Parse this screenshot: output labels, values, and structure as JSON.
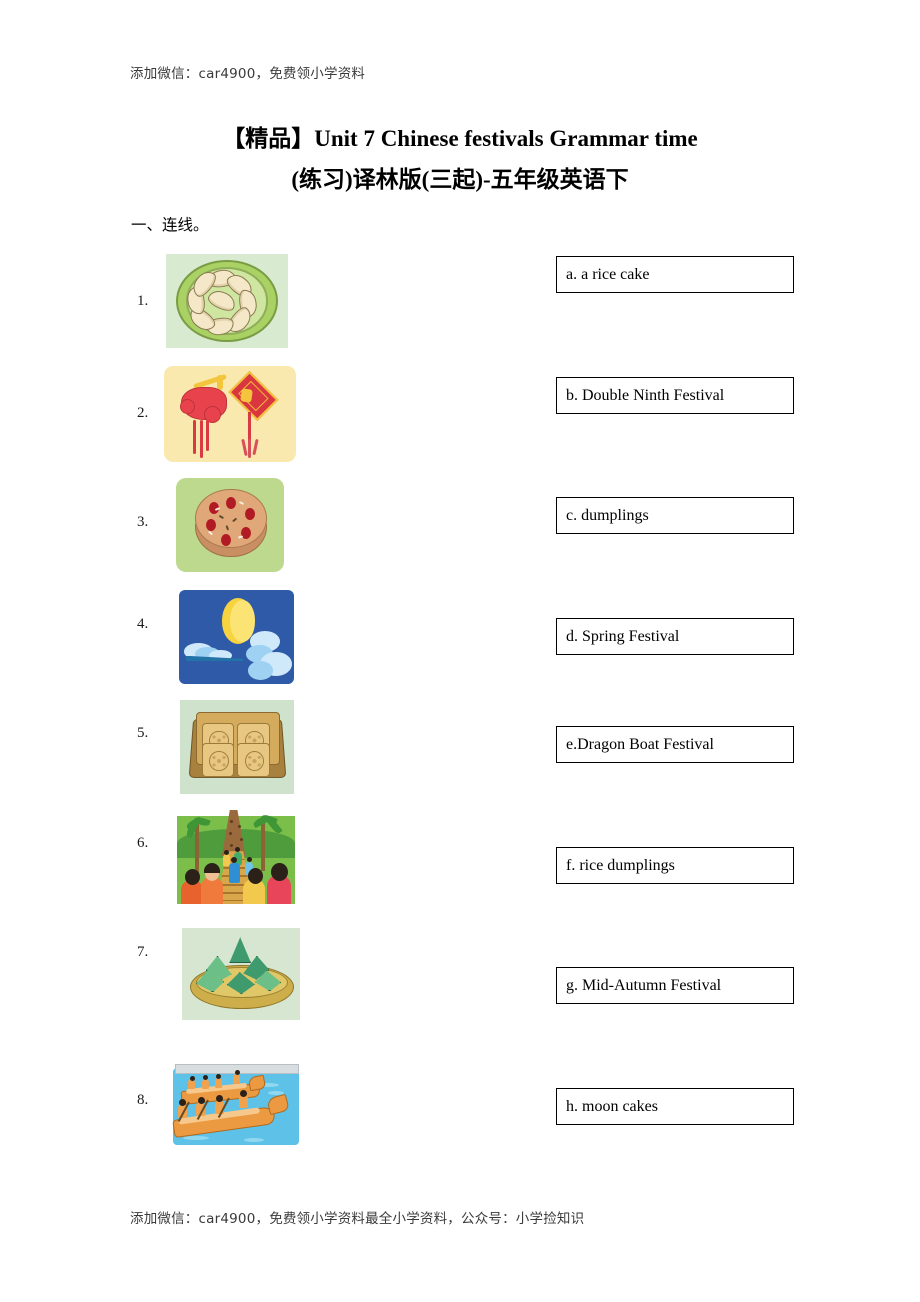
{
  "document": {
    "watermark_top": "添加微信：car4900，免费领小学资料",
    "watermark_bottom": "添加微信：car4900，免费领小学资料最全小学资料，公众号：小学捡知识",
    "title_line1": "【精品】Unit 7 Chinese festivals Grammar time",
    "title_line2": "(练习)译林版(三起)-五年级英语下",
    "section_heading": "一、连线。"
  },
  "exercise": {
    "numbers": [
      "1.",
      "2.",
      "3.",
      "4.",
      "5.",
      "6.",
      "7.",
      "8."
    ],
    "pictures": [
      {
        "number": "1.",
        "alt": "dumplings-on-green-plate"
      },
      {
        "number": "2.",
        "alt": "spring-festival-decorations"
      },
      {
        "number": "3.",
        "alt": "rice-cake-with-red-dates"
      },
      {
        "number": "4.",
        "alt": "moon-in-night-sky-with-clouds"
      },
      {
        "number": "5.",
        "alt": "box-of-moon-cakes"
      },
      {
        "number": "6.",
        "alt": "people-climbing-mountain-steps"
      },
      {
        "number": "7.",
        "alt": "rice-dumplings-zongzi-in-basket"
      },
      {
        "number": "8.",
        "alt": "dragon-boat-race"
      }
    ],
    "options": [
      {
        "key": "a",
        "label": "a. a rice cake"
      },
      {
        "key": "b",
        "label": "b. Double Ninth Festival"
      },
      {
        "key": "c",
        "label": "c. dumplings"
      },
      {
        "key": "d",
        "label": "d. Spring Festival"
      },
      {
        "key": "e",
        "label": "e.Dragon Boat Festival"
      },
      {
        "key": "f",
        "label": "f. rice dumplings"
      },
      {
        "key": "g",
        "label": "g. Mid-Autumn Festival"
      },
      {
        "key": "h",
        "label": "h. moon cakes"
      }
    ]
  },
  "colors": {
    "text": "#000000",
    "watermark": "#3a3a3a",
    "box_border": "#000000",
    "page_background": "#ffffff"
  }
}
